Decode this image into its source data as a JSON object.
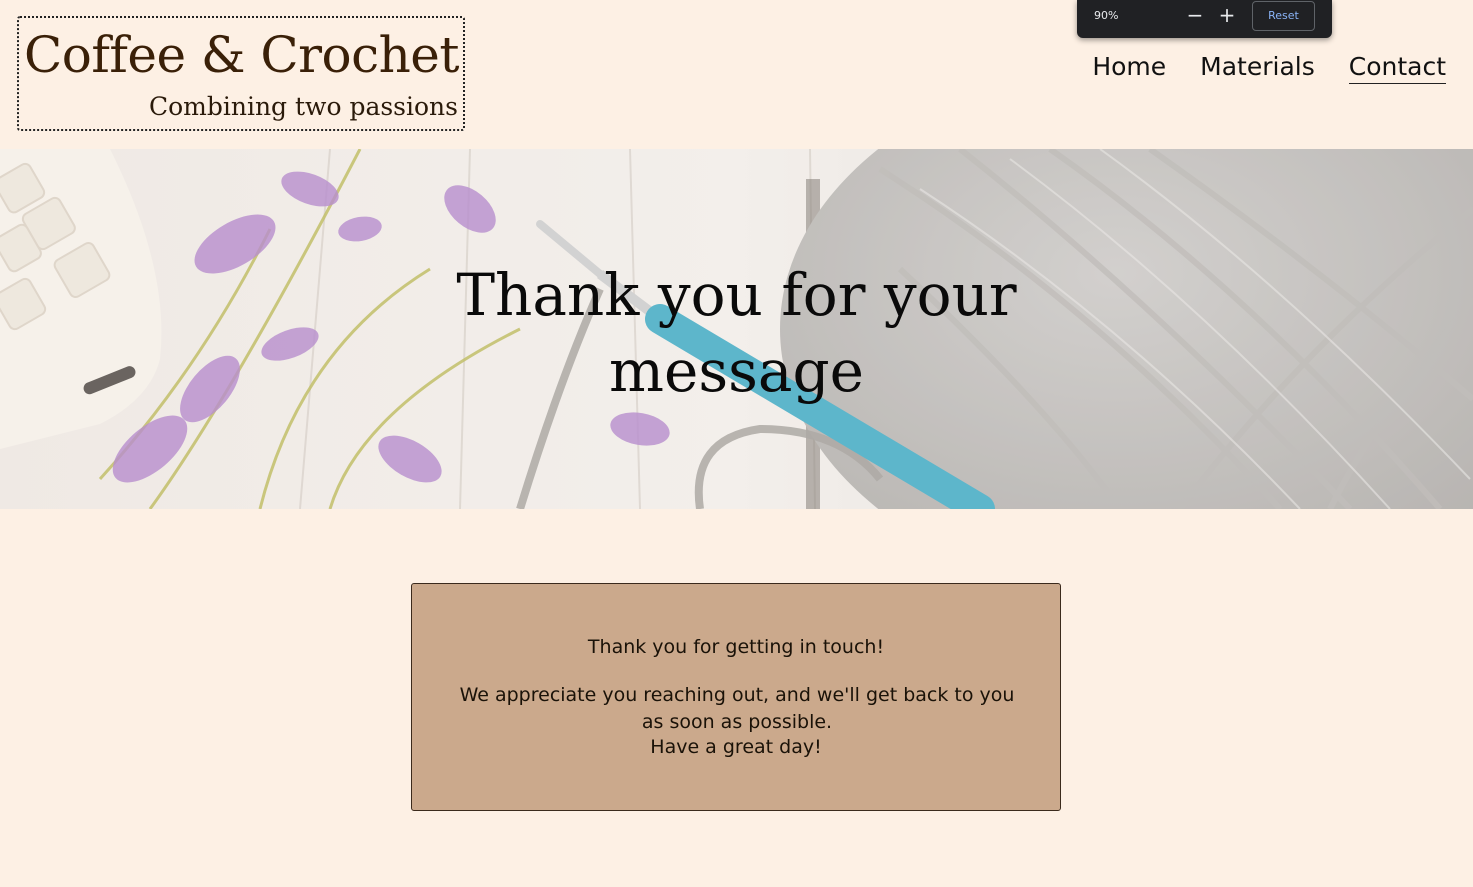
{
  "header": {
    "logo_title": "Coffee & Crochet",
    "logo_tagline": "Combining two passions",
    "nav": [
      {
        "label": "Home",
        "active": false
      },
      {
        "label": "Materials",
        "active": false
      },
      {
        "label": "Contact",
        "active": true
      }
    ]
  },
  "zoom_popup": {
    "level": "90%",
    "minus_icon": "minus-icon",
    "plus_icon": "plus-icon",
    "reset_label": "Reset"
  },
  "hero": {
    "title_line1": "Thank you for your",
    "title_line2": "message",
    "image": "keyboard, purple flowers, crochet hook and grey yarn on white wood"
  },
  "message": {
    "line1": "Thank you for getting in touch!",
    "line2": "We appreciate you reaching out, and we'll get back to you as soon as possible.",
    "line3": "Have a great day!"
  },
  "colors": {
    "page_background": "#fdf0e4",
    "logo_text": "#3a2008",
    "message_box": "#cba98c",
    "hook_accent": "#3aa6c0",
    "zoom_bg": "#202124",
    "zoom_reset_text": "#8ab4f8"
  }
}
